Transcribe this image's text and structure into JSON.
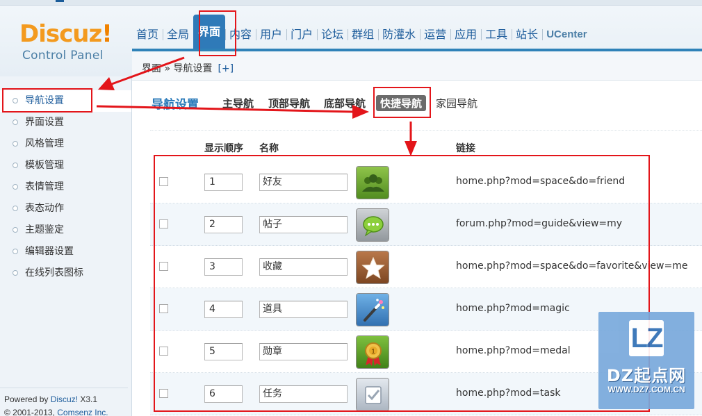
{
  "brand": {
    "name": "Discuz",
    "bang": "!",
    "subtitle": "Control Panel"
  },
  "topnav": [
    {
      "label": "首页"
    },
    {
      "label": "全局"
    },
    {
      "label": "界面",
      "active": true
    },
    {
      "label": "内容"
    },
    {
      "label": "用户"
    },
    {
      "label": "门户"
    },
    {
      "label": "论坛"
    },
    {
      "label": "群组"
    },
    {
      "label": "防灌水"
    },
    {
      "label": "运营"
    },
    {
      "label": "应用"
    },
    {
      "label": "工具"
    },
    {
      "label": "站长"
    },
    {
      "label": "UCenter"
    }
  ],
  "breadcrumb": {
    "text": "界面 » 导航设置",
    "add": "[+]"
  },
  "sidebar": {
    "items": [
      {
        "label": "导航设置",
        "active": true
      },
      {
        "label": "界面设置"
      },
      {
        "label": "风格管理"
      },
      {
        "label": "模板管理"
      },
      {
        "label": "表情管理"
      },
      {
        "label": "表态动作"
      },
      {
        "label": "主题鉴定"
      },
      {
        "label": "编辑器设置"
      },
      {
        "label": "在线列表图标"
      }
    ],
    "footer": {
      "powered_prefix": "Powered by ",
      "powered_link": "Discuz!",
      "version": " X3.1",
      "copyright_prefix": "© 2001-2013, ",
      "company": "Comsenz Inc."
    }
  },
  "page": {
    "title": "导航设置",
    "subtabs": [
      {
        "label": "主导航"
      },
      {
        "label": "顶部导航"
      },
      {
        "label": "底部导航"
      },
      {
        "label": "快捷导航",
        "active": true
      },
      {
        "label": "家园导航"
      }
    ]
  },
  "table": {
    "headers": {
      "order": "显示顺序",
      "name": "名称",
      "link": "链接"
    },
    "rows": [
      {
        "order": "1",
        "name": "好友",
        "icon": "friends-icon",
        "link": "home.php?mod=space&do=friend"
      },
      {
        "order": "2",
        "name": "帖子",
        "icon": "chat-bubble-icon",
        "link": "forum.php?mod=guide&view=my"
      },
      {
        "order": "3",
        "name": "收藏",
        "icon": "star-icon",
        "link": "home.php?mod=space&do=favorite&view=me"
      },
      {
        "order": "4",
        "name": "道具",
        "icon": "magic-wand-icon",
        "link": "home.php?mod=magic"
      },
      {
        "order": "5",
        "name": "勋章",
        "icon": "medal-icon",
        "link": "home.php?mod=medal"
      },
      {
        "order": "6",
        "name": "任务",
        "icon": "task-check-icon",
        "link": "home.php?mod=task"
      }
    ]
  },
  "watermark": {
    "logo_text": "LZ",
    "name": "DZ起点网",
    "url": "WWW.DZ7.COM.CN"
  },
  "colors": {
    "accent_blue": "#2f7ab8",
    "annotation_red": "#e3151a",
    "brand_orange": "#f39a1f"
  }
}
